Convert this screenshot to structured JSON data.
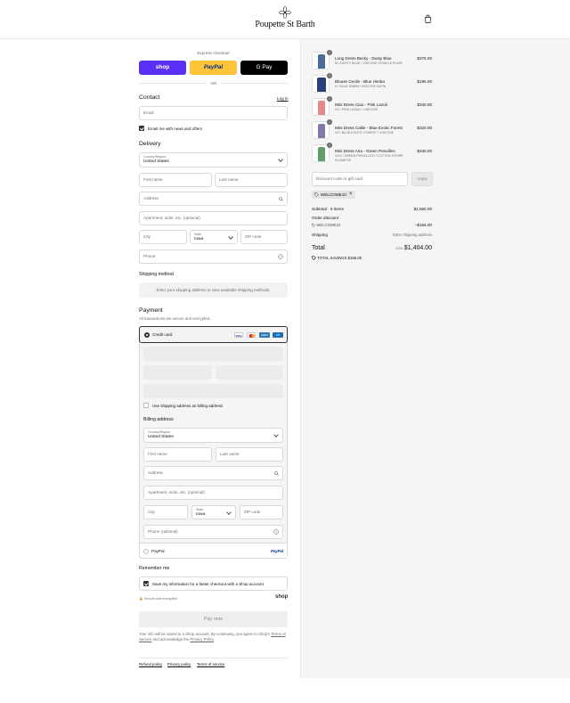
{
  "header": {
    "brand": "Poupette St Barth"
  },
  "express": {
    "title": "Express checkout",
    "shop": "shop",
    "paypal": "PayPal",
    "gpay": "G Pay",
    "or": "OR"
  },
  "contact": {
    "title": "Contact",
    "login": "Log in",
    "email_placeholder": "Email",
    "news_label": "Email me with news and offers"
  },
  "delivery": {
    "title": "Delivery",
    "country_label": "Country/Region",
    "country_value": "United States",
    "first": "First name",
    "last": "Last name",
    "address": "Address",
    "apt": "Apartment, suite, etc. (optional)",
    "city": "City",
    "state_label": "State",
    "state_value": "Iowa",
    "zip": "ZIP code",
    "phone": "Phone"
  },
  "shipping": {
    "title": "Shipping method",
    "message": "Enter your shipping address to view available shipping methods."
  },
  "payment": {
    "title": "Payment",
    "subtitle": "All transactions are secure and encrypted.",
    "credit_card": "Credit card",
    "cards": [
      "VISA",
      "MC",
      "AMEX",
      "UP"
    ],
    "use_shipping": "Use shipping address as billing address",
    "billing_title": "Billing address",
    "billing": {
      "country_label": "Country/Region",
      "country_value": "United States",
      "first": "First name",
      "last": "Last name",
      "address": "Address",
      "apt": "Apartment, suite, etc. (optional)",
      "city": "City",
      "state_label": "State",
      "state_value": "Iowa",
      "zip": "ZIP code",
      "phone": "Phone (optional)"
    },
    "paypal_label": "PayPal",
    "paypal_logo": "PayPal"
  },
  "remember": {
    "title": "Remember me",
    "save_label": "Save my information for a faster checkout with a Shop account",
    "secure": "Secure and encrypted",
    "shop_logo": "shop"
  },
  "pay_now": "Pay now",
  "legal": {
    "pre": "Your info will be saved to a Shop account. By continuing, you agree to Shop's",
    "terms": "Terms of Service",
    "mid": "and acknowledge the",
    "privacy": "Privacy Policy",
    "end": "."
  },
  "footer": {
    "refund": "Refund policy",
    "privacy": "Privacy policy",
    "terms": "Terms of service"
  },
  "cart": {
    "items": [
      {
        "qty": "1",
        "name": "Long Dress Becky - Dusty Blue",
        "variant": "M / DUSTY BLUE / VISCOSE CRINKLE PLAIN",
        "price": "$375.00",
        "color": "#4a6a9a"
      },
      {
        "qty": "1",
        "name": "Blouse Cecile - Blue Himba",
        "variant": "S / BLUE HIMBA / VISCOSE SATIN",
        "price": "$195.00",
        "color": "#2b3f7a"
      },
      {
        "qty": "1",
        "name": "Mini Dress Ciao - Pink Lazuli",
        "variant": "XS / PINK LAZULI / VISCOSE",
        "price": "$340.00",
        "color": "#e48a8a"
      },
      {
        "qty": "1",
        "name": "Mini Dress Callie - Blue Exotic Forest",
        "variant": "XS / BLUE EXOTIC FOREST / VISCOSE",
        "price": "$320.00",
        "color": "#7f7aa8"
      },
      {
        "qty": "1",
        "name": "Mini Dress Aria - Green Pencilleo",
        "variant": "XOS / GREEN PENCILLEO / COTTON STRIPE PLUMETIS",
        "price": "$340.00",
        "color": "#5fa06a"
      }
    ],
    "discount_placeholder": "Discount code or gift card",
    "apply": "Apply",
    "code": "WELCOME10",
    "subtotal_label": "Subtotal · 5 items",
    "subtotal": "$1,560.00",
    "order_discount": "Order discount",
    "discount_code": "WELCOME10",
    "discount_value": "−$156.00",
    "shipping_label": "Shipping",
    "shipping_value": "Enter shipping address",
    "total_label": "Total",
    "currency": "USD",
    "total": "$1,404.00",
    "savings_label": "TOTAL SAVINGS",
    "savings": "$156.00"
  }
}
